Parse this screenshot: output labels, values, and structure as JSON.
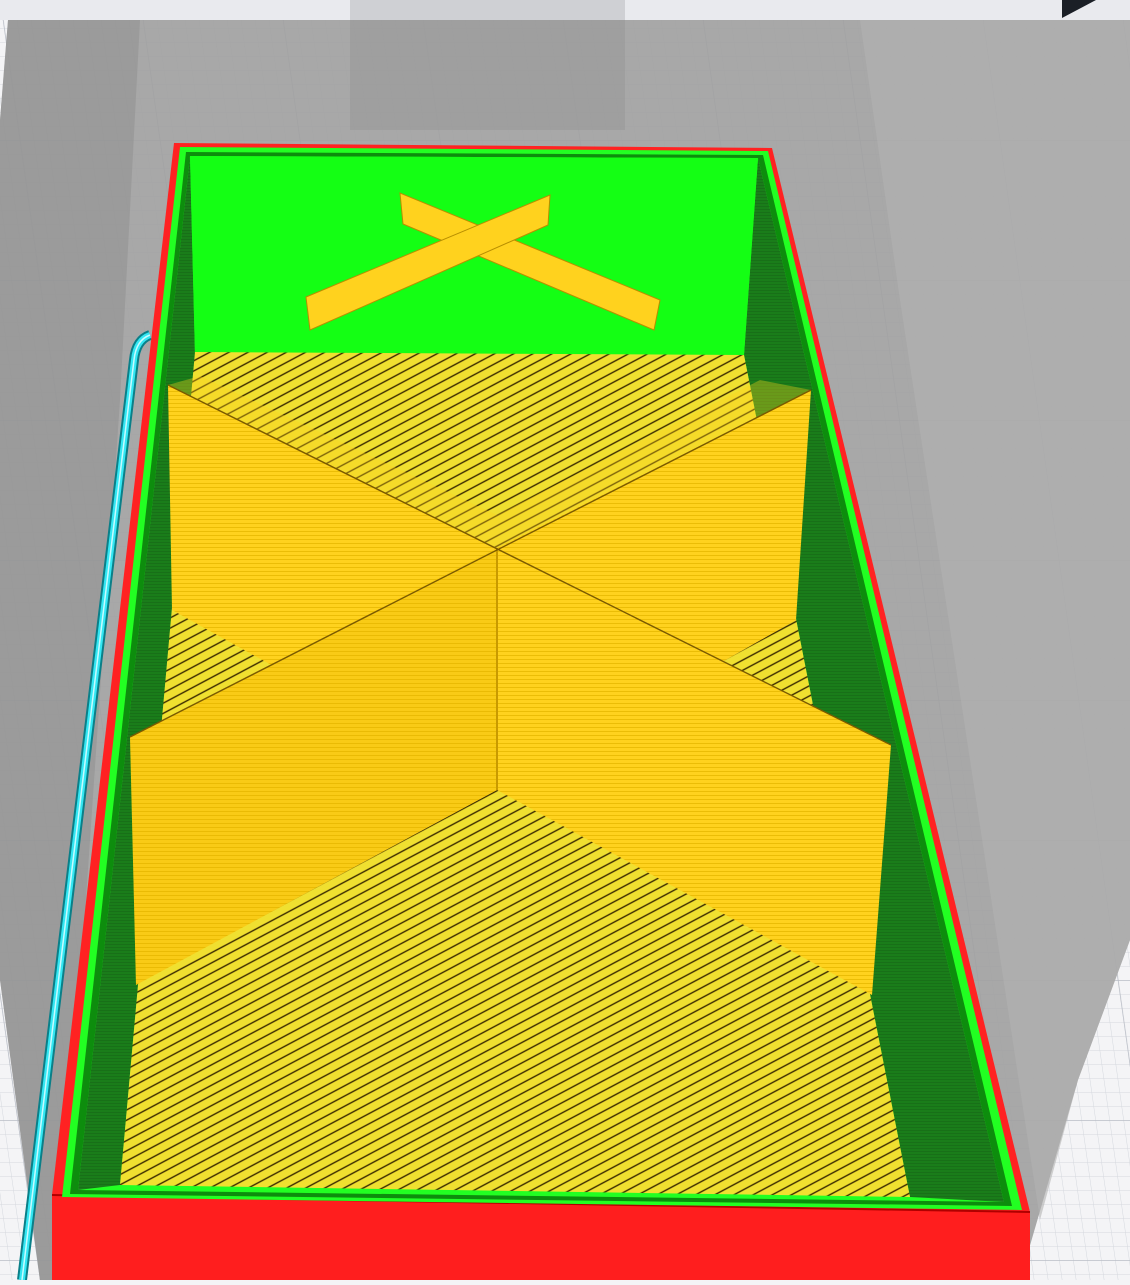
{
  "viewer": {
    "colors": {
      "background": "#f4f4f6",
      "grid_minor": "#d5d8de",
      "grid_major": "#b9bdc6",
      "build_volume_shadow": "#9c9c9c",
      "toolbar_strip": "#c8c8c8",
      "skirt_travel": "#33e6f2",
      "outer_wall": "#ff2222",
      "inner_wall": "#22ff22",
      "inner_wall_shaded": "#1a7d1a",
      "infill": "#ffd21e",
      "skin": "#f0e030",
      "line_dark": "#3a2a00"
    },
    "icons": [
      "play-arrow-icon"
    ]
  }
}
